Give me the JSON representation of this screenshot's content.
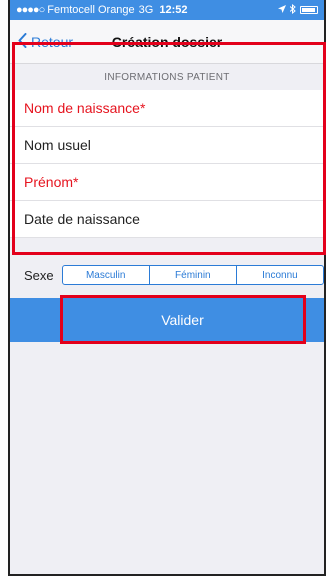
{
  "status_bar": {
    "signal": "●●●●○",
    "carrier": "Femtocell Orange",
    "network": "3G",
    "time": "12:52",
    "icons_right": [
      "location-icon",
      "bluetooth-icon",
      "battery-icon"
    ]
  },
  "nav": {
    "back_label": "Retour",
    "title": "Création dossier"
  },
  "form": {
    "section_header": "INFORMATIONS PATIENT",
    "fields": [
      {
        "label": "Nom de naissance*",
        "required": true
      },
      {
        "label": "Nom usuel",
        "required": false
      },
      {
        "label": "Prénom*",
        "required": true
      },
      {
        "label": "Date de naissance",
        "required": false
      }
    ],
    "sex": {
      "label": "Sexe",
      "options": [
        "Masculin",
        "Féminin",
        "Inconnu"
      ]
    },
    "submit_label": "Valider"
  },
  "colors": {
    "accent": "#2b7bd6",
    "bar_blue": "#3f8ee3",
    "required_red": "#e6141f",
    "highlight_red": "#e3001b",
    "background": "#efeff4"
  }
}
